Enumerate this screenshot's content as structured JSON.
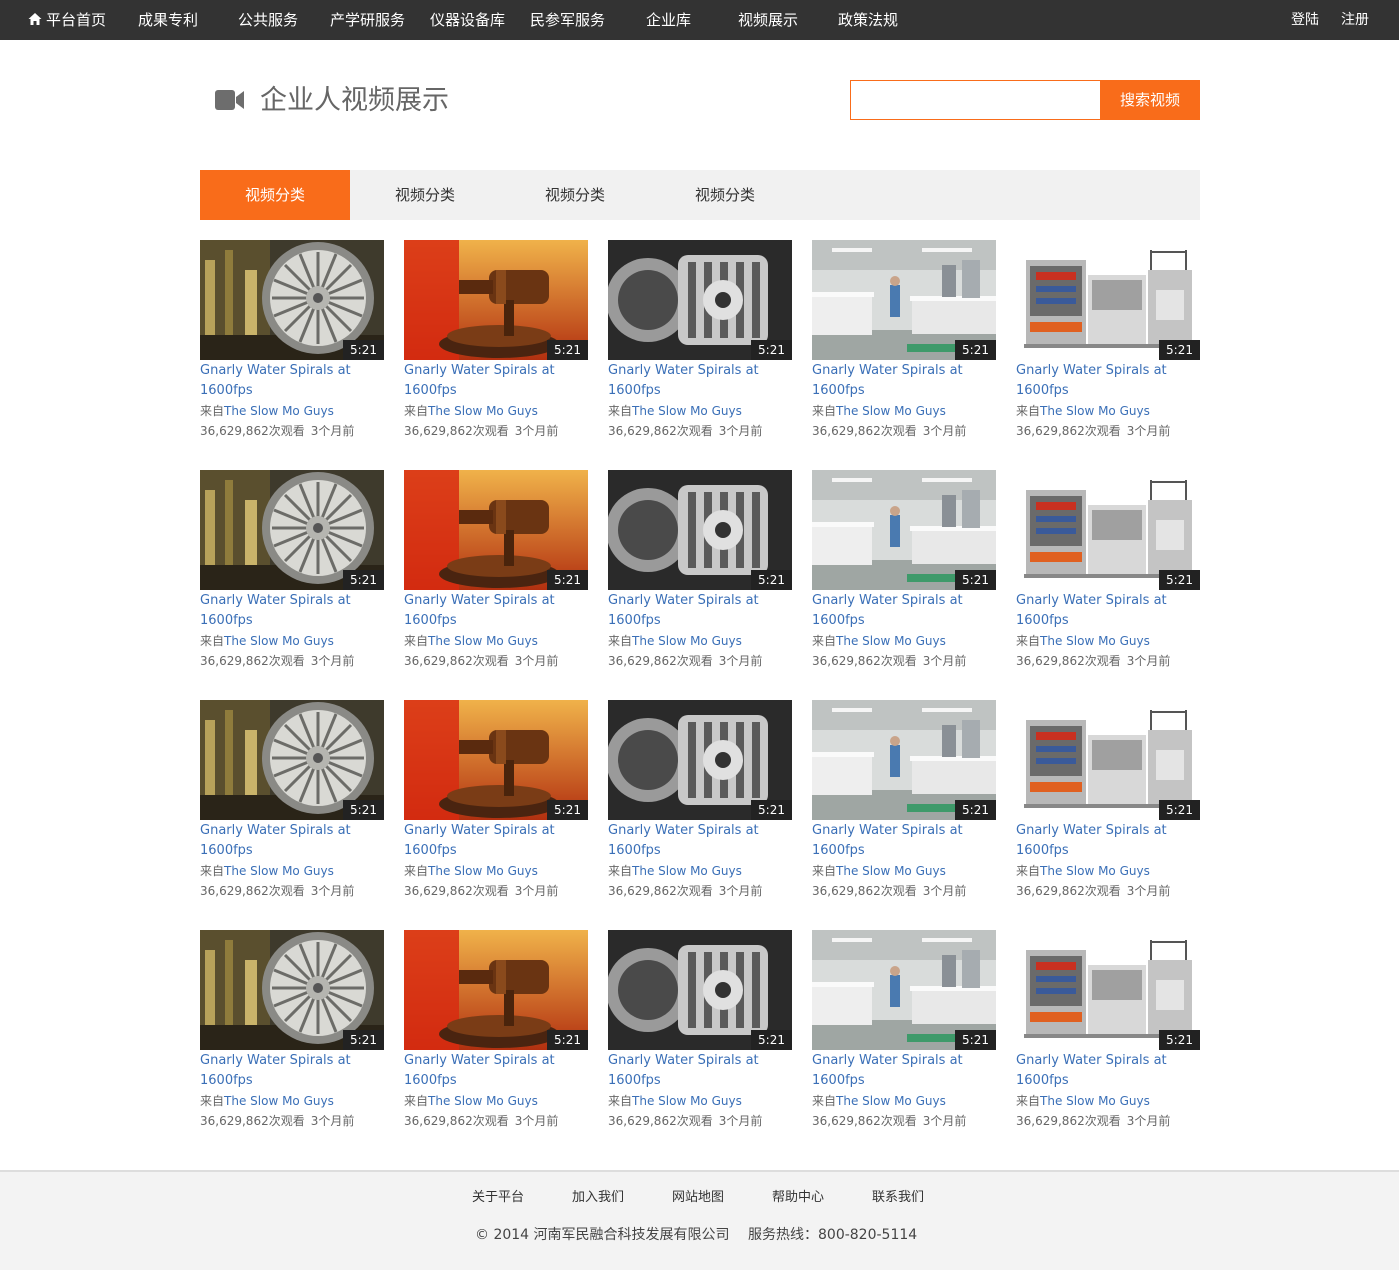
{
  "nav": {
    "items": [
      "平台首页",
      "成果专利",
      "公共服务",
      "产学研服务",
      "仪器设备库",
      "民参军服务",
      "企业库",
      "视频展示",
      "政策法规"
    ],
    "login": "登陆",
    "register": "注册"
  },
  "header": {
    "title": "企业人视频展示",
    "search_placeholder": "",
    "search_button": "搜索视频"
  },
  "tabs": [
    "视频分类",
    "视频分类",
    "视频分类",
    "视频分类"
  ],
  "videos": {
    "title": "Gnarly Water Spirals at 1600fps",
    "source_prefix": "来自",
    "channel": "The Slow Mo Guys",
    "views": "36,629,862次观看",
    "ago": "3个月前",
    "duration": "5:21",
    "thumbnails": [
      "jet-engine",
      "gavel",
      "gearbox",
      "laboratory",
      "printing-press"
    ],
    "rows": 4
  },
  "footer": {
    "links": [
      "关于平台",
      "加入我们",
      "网站地图",
      "帮助中心",
      "联系我们"
    ],
    "copyright": "© 2014 河南军民融合科技发展有限公司",
    "hotline": "服务热线：800-820-5114"
  },
  "colors": {
    "accent": "#f96c1a",
    "nav_bg": "#333333",
    "link": "#3a6fb7"
  }
}
